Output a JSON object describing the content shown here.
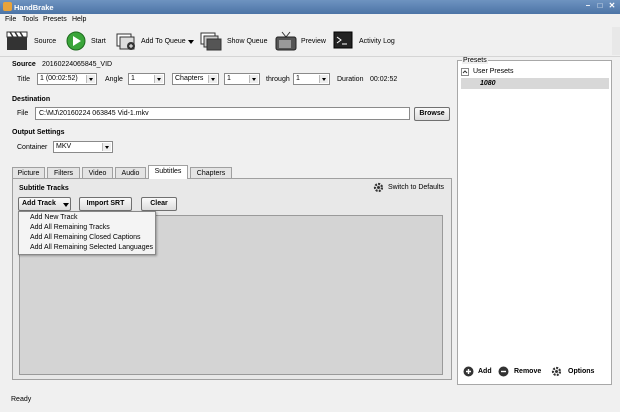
{
  "window": {
    "title": "HandBrake"
  },
  "menu": [
    "File",
    "Tools",
    "Presets",
    "Help"
  ],
  "toolbar": {
    "source": "Source",
    "start": "Start",
    "add_to_queue": "Add To Queue",
    "show_queue": "Show Queue",
    "preview": "Preview",
    "activity_log": "Activity Log"
  },
  "source": {
    "label": "Source",
    "value": "20160224065845_VID",
    "title_label": "Title",
    "title_value": "1 (00:02:52)",
    "angle_label": "Angle",
    "angle_value": "1",
    "range_type": "Chapters",
    "range_start": "1",
    "through_label": "through",
    "range_end": "1",
    "duration_label": "Duration",
    "duration_value": "00:02:52"
  },
  "destination": {
    "heading": "Destination",
    "file_label": "File",
    "file_value": "C:\\MJ\\20160224 063845 Vid-1.mkv",
    "browse": "Browse"
  },
  "output": {
    "heading": "Output Settings",
    "container_label": "Container",
    "container_value": "MKV"
  },
  "tabs": [
    "Picture",
    "Filters",
    "Video",
    "Audio",
    "Subtitles",
    "Chapters"
  ],
  "subtitles": {
    "heading": "Subtitle Tracks",
    "switch_defaults": "Switch to Defaults",
    "add_track": "Add Track",
    "import_srt": "Import SRT",
    "clear": "Clear",
    "menu_items": [
      "Add New Track",
      "Add All Remaining Tracks",
      "Add All Remaining Closed Captions",
      "Add All Remaining Selected Languages"
    ]
  },
  "presets": {
    "heading": "Presets",
    "group": "User Presets",
    "item": "1080",
    "add": "Add",
    "remove": "Remove",
    "options": "Options"
  },
  "status": {
    "text": "Ready"
  }
}
